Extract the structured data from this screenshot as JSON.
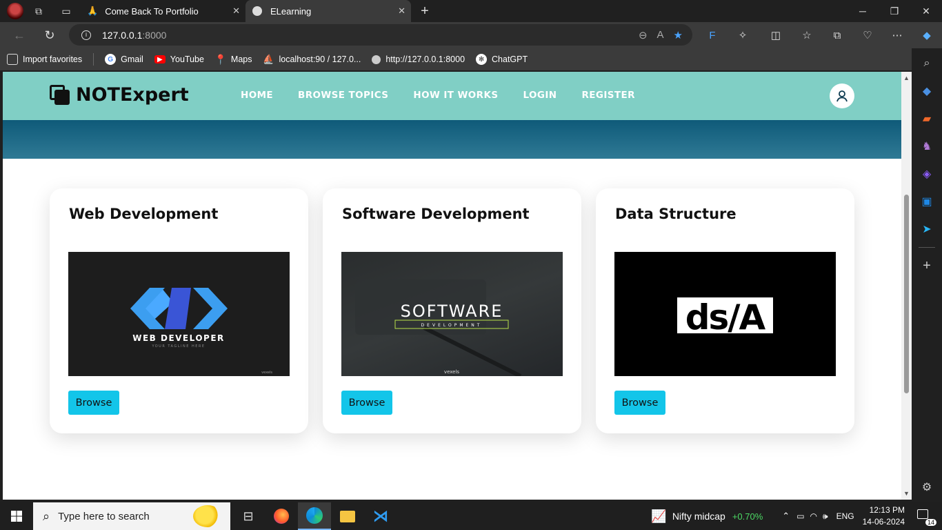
{
  "browser": {
    "tabs": [
      {
        "title": "Come Back To Portfolio",
        "active": false
      },
      {
        "title": "ELearning",
        "active": true
      }
    ],
    "address": {
      "host": "127.0.0.1",
      "port": ":8000"
    },
    "bookmarks": [
      {
        "label": "Import favorites",
        "icon": "import-icon"
      },
      {
        "label": "Gmail",
        "icon": "google-icon"
      },
      {
        "label": "YouTube",
        "icon": "youtube-icon"
      },
      {
        "label": "Maps",
        "icon": "maps-icon"
      },
      {
        "label": "localhost:90 / 127.0...",
        "icon": "phpmyadmin-icon"
      },
      {
        "label": "http://127.0.0.1:8000",
        "icon": "globe-icon"
      },
      {
        "label": "ChatGPT",
        "icon": "chatgpt-icon"
      }
    ]
  },
  "site": {
    "logo": "NOTExpert",
    "nav": [
      "HOME",
      "BROWSE TOPICS",
      "HOW IT WORKS",
      "LOGIN",
      "REGISTER"
    ],
    "colors": {
      "header": "#80cfc5",
      "hero": "#1b6885",
      "button": "#13c5e9"
    },
    "courses": [
      {
        "title": "Web Development",
        "button": "Browse",
        "image": {
          "heading": "WEB DEVELOPER",
          "tagline": "YOUR TAGLINE HERE",
          "credit": "vexels"
        }
      },
      {
        "title": "Software Development",
        "button": "Browse",
        "image": {
          "heading": "SOFTWARE",
          "sub": "DEVELOPMENT",
          "credit": "vexels"
        }
      },
      {
        "title": "Data Structure",
        "button": "Browse",
        "image": {
          "heading": "ds/A"
        }
      }
    ]
  },
  "taskbar": {
    "search_placeholder": "Type here to search",
    "ticker": {
      "name": "Nifty midcap",
      "change": "+0.70%"
    },
    "lang": "ENG",
    "time": "12:13 PM",
    "date": "14-06-2024",
    "notifications": "14"
  }
}
